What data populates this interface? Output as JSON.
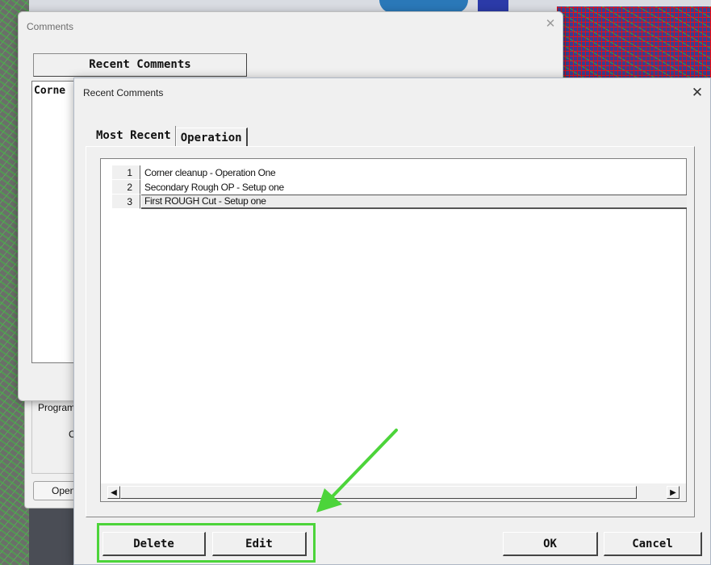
{
  "comments_window": {
    "title": "Comments",
    "close_glyph": "✕",
    "recent_button_label": "Recent Comments",
    "comment_text_visible": "Corne"
  },
  "program_panel": {
    "program_label": "Program",
    "c_label": "C",
    "open_button_label": "Open"
  },
  "dialog": {
    "title": "Recent Comments",
    "close_glyph": "✕",
    "tabs": [
      {
        "label": "Most Recent",
        "active": true
      },
      {
        "label": "Operation",
        "active": false
      }
    ],
    "rows": [
      {
        "index": "1",
        "text": "Corner cleanup - Operation One"
      },
      {
        "index": "2",
        "text": "Secondary Rough OP - Setup one"
      },
      {
        "index": "3",
        "text": "First ROUGH Cut - Setup one",
        "selected": true
      }
    ],
    "scroll_left_glyph": "◀",
    "scroll_right_glyph": "▶",
    "buttons": {
      "delete": "Delete",
      "edit": "Edit",
      "ok": "OK",
      "cancel": "Cancel"
    }
  },
  "colors": {
    "annotation_green": "#4cd43a",
    "dialog_bg": "#f0f0f0",
    "list_bg": "#ffffff"
  }
}
